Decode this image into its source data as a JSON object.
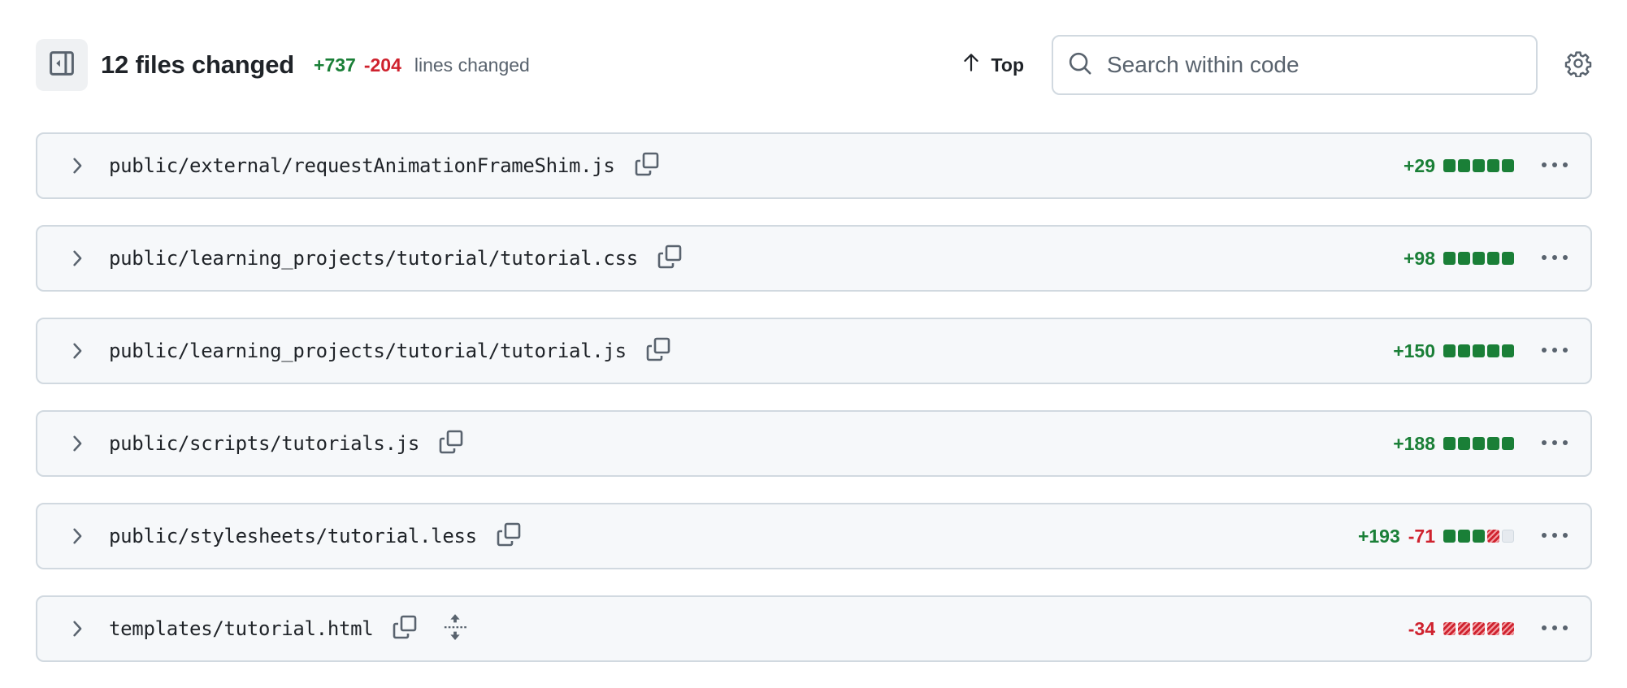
{
  "header": {
    "title": "12 files changed",
    "additions": "+737",
    "deletions": "-204",
    "lines_label": "lines changed",
    "top_label": "Top",
    "search_placeholder": "Search within code",
    "search_value": ""
  },
  "icons": {
    "sidebar_toggle": "sidebar-collapse-icon",
    "top": "arrow-up-icon",
    "search": "search-icon",
    "settings": "gear-icon",
    "expand_row": "chevron-right-icon",
    "copy": "copy-icon",
    "expand_all": "unfold-icon",
    "more": "kebab-horizontal-icon"
  },
  "colors": {
    "added": "#1a7f37",
    "deleted": "#cf222e",
    "neutral": "#e6eaef",
    "row_bg": "#f6f8fa",
    "border": "#d1d9e0"
  },
  "files": [
    {
      "path": "public/external/requestAnimationFrameShim.js",
      "additions": "+29",
      "deletions": "",
      "blocks": [
        "added",
        "added",
        "added",
        "added",
        "added"
      ],
      "show_expand": false
    },
    {
      "path": "public/learning_projects/tutorial/tutorial.css",
      "additions": "+98",
      "deletions": "",
      "blocks": [
        "added",
        "added",
        "added",
        "added",
        "added"
      ],
      "show_expand": false
    },
    {
      "path": "public/learning_projects/tutorial/tutorial.js",
      "additions": "+150",
      "deletions": "",
      "blocks": [
        "added",
        "added",
        "added",
        "added",
        "added"
      ],
      "show_expand": false
    },
    {
      "path": "public/scripts/tutorials.js",
      "additions": "+188",
      "deletions": "",
      "blocks": [
        "added",
        "added",
        "added",
        "added",
        "added"
      ],
      "show_expand": false
    },
    {
      "path": "public/stylesheets/tutorial.less",
      "additions": "+193",
      "deletions": "-71",
      "blocks": [
        "added",
        "added",
        "added",
        "deleted",
        "neutral"
      ],
      "show_expand": false
    },
    {
      "path": "templates/tutorial.html",
      "additions": "",
      "deletions": "-34",
      "blocks": [
        "deleted",
        "deleted",
        "deleted",
        "deleted",
        "deleted"
      ],
      "show_expand": true
    }
  ]
}
